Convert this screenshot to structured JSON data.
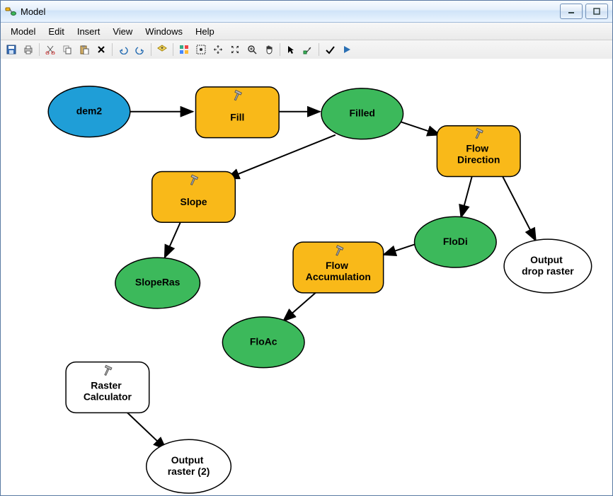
{
  "window": {
    "title": "Model"
  },
  "menu": {
    "items": [
      "Model",
      "Edit",
      "Insert",
      "View",
      "Windows",
      "Help"
    ]
  },
  "toolbar": {
    "icons": [
      "save",
      "print",
      "cut",
      "copy",
      "paste",
      "delete",
      "undo",
      "redo",
      "add-data",
      "tile",
      "select-all",
      "fit-window",
      "full-extent",
      "zoom-in",
      "pan",
      "pointer",
      "connect",
      "validate",
      "run"
    ]
  },
  "nodes": {
    "dem2": {
      "type": "data-input",
      "label": "dem2"
    },
    "fill": {
      "type": "tool",
      "label": "Fill"
    },
    "filled": {
      "type": "data-output",
      "label": "Filled"
    },
    "flowdir": {
      "type": "tool",
      "label": "Flow Direction",
      "label2": [
        "Flow",
        "Direction"
      ]
    },
    "slope": {
      "type": "tool",
      "label": "Slope"
    },
    "flodi": {
      "type": "data-output",
      "label": "FloDi"
    },
    "outdrop": {
      "type": "data-empty",
      "label": "Output drop raster",
      "label2": [
        "Output",
        "drop raster"
      ]
    },
    "sloperas": {
      "type": "data-output",
      "label": "SlopeRas"
    },
    "flowacc": {
      "type": "tool",
      "label": "Flow Accumulation",
      "label2": [
        "Flow",
        "Accumulation"
      ]
    },
    "floac": {
      "type": "data-output",
      "label": "FloAc"
    },
    "rascalc": {
      "type": "tool-empty",
      "label": "Raster Calculator",
      "label2": [
        "Raster",
        "Calculator"
      ]
    },
    "outraster2": {
      "type": "data-empty",
      "label": "Output raster (2)",
      "label2": [
        "Output",
        "raster (2)"
      ]
    }
  },
  "edges": [
    [
      "dem2",
      "fill"
    ],
    [
      "fill",
      "filled"
    ],
    [
      "filled",
      "flowdir"
    ],
    [
      "filled",
      "slope"
    ],
    [
      "flowdir",
      "flodi"
    ],
    [
      "flowdir",
      "outdrop"
    ],
    [
      "slope",
      "sloperas"
    ],
    [
      "flodi",
      "flowacc"
    ],
    [
      "flowacc",
      "floac"
    ],
    [
      "rascalc",
      "outraster2"
    ]
  ],
  "colors": {
    "tool": "#f9b919",
    "data_input": "#1f9ed7",
    "data_output": "#3cb95b",
    "empty": "#ffffff"
  }
}
